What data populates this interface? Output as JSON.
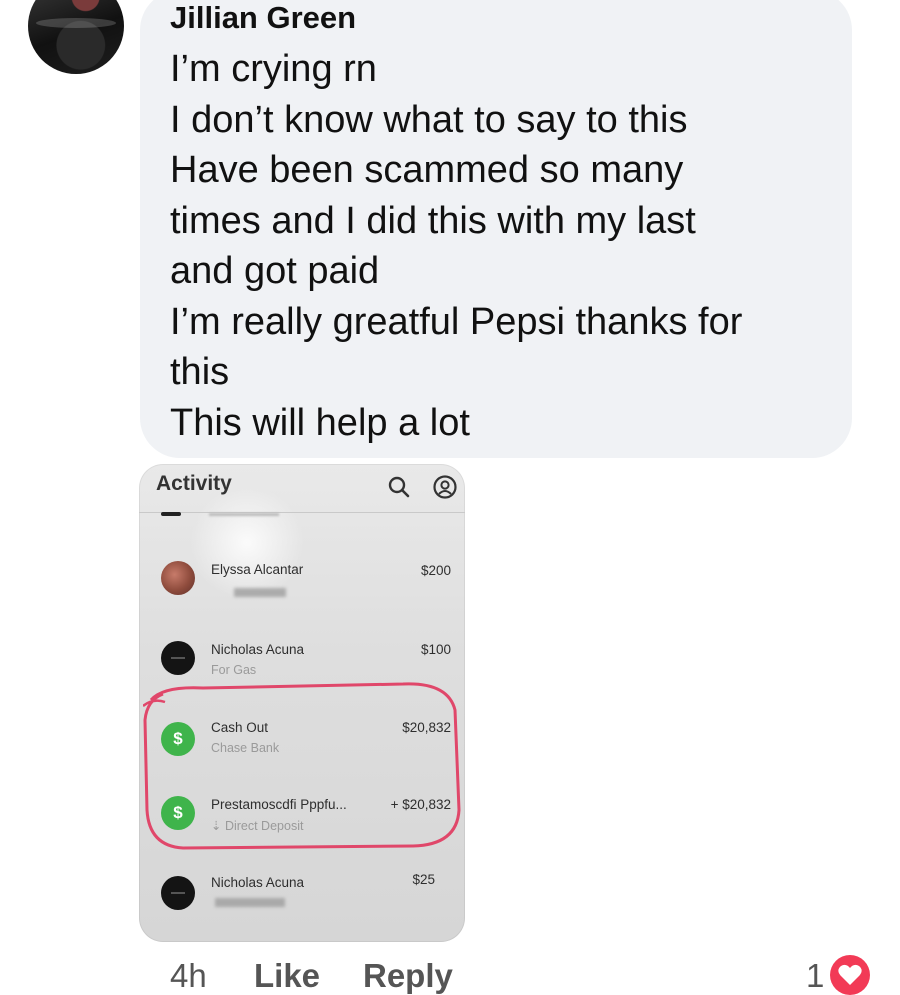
{
  "comment": {
    "author": "Jillian Green",
    "lines": [
      "I’m crying rn",
      "I don’t know what to say to this",
      "Have been scammed so many",
      "times and I did this with my last",
      "and got paid",
      "I’m really greatful Pepsi thanks for",
      "this",
      "This will help a lot"
    ]
  },
  "screenshot": {
    "title": "Activity",
    "icons": [
      "search-icon",
      "profile-icon"
    ],
    "transactions": [
      {
        "name": "Elyssa Alcantar",
        "sub": "",
        "amount": "$200",
        "avatar": "photo"
      },
      {
        "name": "Nicholas Acuna",
        "sub": "For Gas",
        "amount": "$100",
        "avatar": "dark"
      },
      {
        "name": "Cash Out",
        "sub": "Chase Bank",
        "amount": "$20,832",
        "avatar": "dollar",
        "icon_text": "$"
      },
      {
        "name": "Prestamoscdfi Pppfu...",
        "sub": "⇣ Direct Deposit",
        "amount": "+ $20,832",
        "avatar": "dollar",
        "icon_text": "$"
      },
      {
        "name": "Nicholas Acuna",
        "sub": "",
        "amount": "$25",
        "avatar": "dark"
      }
    ],
    "highlight_color": "#e0476a",
    "accent_green": "#3fb44b"
  },
  "actions": {
    "time": "4h",
    "like": "Like",
    "reply": "Reply",
    "reaction_count": "1",
    "reaction_icon": "heart-icon",
    "reaction_color": "#f23a56"
  }
}
